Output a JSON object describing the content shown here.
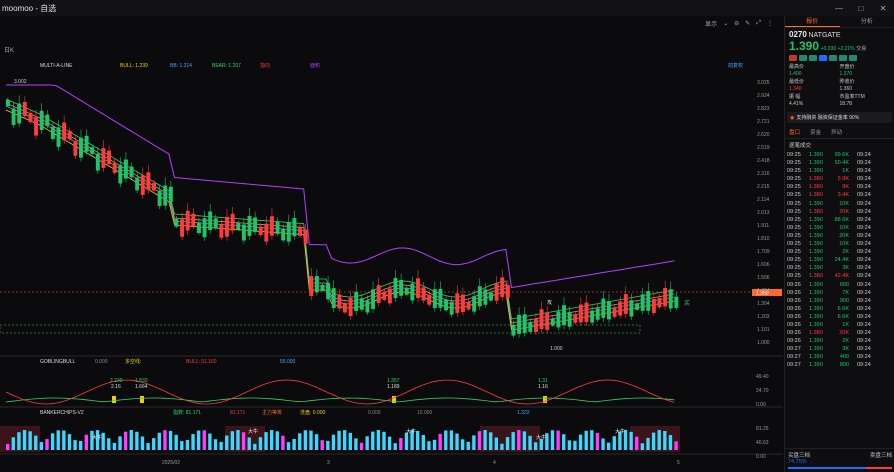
{
  "window": {
    "title": "moomoo - 自选",
    "controls": [
      "—",
      "□",
      "✕"
    ]
  },
  "toolbar": {
    "items": [
      "显示",
      "⌄",
      "⊖",
      "✎",
      "⤢",
      "⋮"
    ]
  },
  "chart": {
    "period_label": "日K",
    "indicator_main": {
      "name": "MULTI-A-LINE",
      "bull": "BULL: 1.239",
      "bb": "BB: 1.214",
      "bear": "BEAR: 1.207",
      "extra1": "指向",
      "extra2": "面积"
    },
    "adjust_label": "前复权",
    "price_axis": [
      "3.025",
      "2.924",
      "2.823",
      "2.721",
      "2.620",
      "2.519",
      "2.418",
      "2.316",
      "2.215",
      "2.114",
      "2.013",
      "1.911",
      "1.810",
      "1.709",
      "1.606",
      "1.506",
      "1.404",
      "1.304",
      "1.203",
      "1.101",
      "1.000"
    ],
    "current_price_tag": "1.390",
    "high_label": "3.002",
    "low_label": "1.000",
    "marker_buy": "买",
    "marker_b": "攻",
    "sub1": {
      "name": "GOBLINGBULL",
      "v1": "0.000",
      "lbl": "多空线:",
      "bull": "BULL: 51.160",
      "v2": "55.000",
      "axis": [
        "49.40",
        "24.70",
        "0.00"
      ],
      "labels": [
        [
          "2.239",
          "2.16"
        ],
        [
          "1.833",
          "1.664"
        ],
        [
          "1.357",
          "1.189"
        ],
        [
          "1.31",
          "1.16"
        ]
      ]
    },
    "sub2": {
      "name": "BANKERCHIPS-V2",
      "a": "指数: 81.171",
      "b": "81.171",
      "c": "主力等筹",
      "d": "洗盘: 0.000",
      "e": "0.000",
      "f": "10.000",
      "g": "1.322",
      "axis": [
        "81.25",
        "40.63",
        "0.00"
      ],
      "tags": [
        "大牛",
        "大牛",
        "大牛",
        "大牛",
        "大牛"
      ]
    },
    "x_axis": [
      "2025/02",
      "3",
      "4",
      "5"
    ]
  },
  "panel": {
    "tabs": [
      "报价",
      "分析"
    ],
    "code": "0270",
    "name": "NATGATE",
    "price": "1.390",
    "change": "+0.030 +2.21%",
    "change_more": "交易",
    "stats": [
      [
        "最高价",
        "1.400",
        "开盘价",
        "1.370"
      ],
      [
        "最低价",
        "1.340",
        "昨收价",
        "1.360"
      ],
      [
        "振   幅",
        "4.41%",
        "市盈率TTM",
        "18.78"
      ]
    ],
    "notice": "支持融资 融资保证金率 90%",
    "subtabs": [
      "盘口",
      "资金",
      "异动"
    ],
    "ticks_title": "逐笔成交",
    "ticks": [
      [
        "09:25",
        "1.390",
        "99.6K",
        "09:24"
      ],
      [
        "09:25",
        "1.390",
        "50.4K",
        "09:24"
      ],
      [
        "09:25",
        "1.390",
        "1K",
        "09:24"
      ],
      [
        "09:25",
        "1.380",
        "5.9K",
        "09:24"
      ],
      [
        "09:25",
        "1.380",
        "8K",
        "09:24"
      ],
      [
        "09:25",
        "1.380",
        "3.4K",
        "09:24"
      ],
      [
        "09:25",
        "1.390",
        "10K",
        "09:24"
      ],
      [
        "09:25",
        "1.380",
        "20K",
        "09:24"
      ],
      [
        "09:25",
        "1.390",
        "88.6K",
        "09:24"
      ],
      [
        "09:25",
        "1.390",
        "10K",
        "09:24"
      ],
      [
        "09:25",
        "1.390",
        "20K",
        "09:24"
      ],
      [
        "09:25",
        "1.390",
        "10K",
        "09:24"
      ],
      [
        "09:25",
        "1.390",
        "2K",
        "09:24"
      ],
      [
        "09:25",
        "1.390",
        "24.4K",
        "09:24"
      ],
      [
        "09:25",
        "1.390",
        "3K",
        "09:24"
      ],
      [
        "09:25",
        "1.380",
        "42.4K",
        "09:24"
      ],
      [
        "09:26",
        "1.390",
        "600",
        "09:24"
      ],
      [
        "09:26",
        "1.390",
        "7K",
        "09:24"
      ],
      [
        "09:26",
        "1.390",
        "900",
        "09:24"
      ],
      [
        "09:26",
        "1.390",
        "6.6K",
        "09:24"
      ],
      [
        "09:26",
        "1.390",
        "6.6K",
        "09:24"
      ],
      [
        "09:26",
        "1.390",
        "1K",
        "09:24"
      ],
      [
        "09:26",
        "1.380",
        "20K",
        "09:24"
      ],
      [
        "09:26",
        "1.390",
        "2K",
        "09:24"
      ],
      [
        "09:27",
        "1.390",
        "3K",
        "09:24"
      ],
      [
        "09:27",
        "1.390",
        "400",
        "09:24"
      ],
      [
        "09:27",
        "1.390",
        "800",
        "09:24"
      ]
    ],
    "buy_label": "买盘三档",
    "sell_label": "卖盘三档",
    "buy_pct": "74.75%",
    "buy_fraction": 0.7475,
    "colors": {
      "up": "#1fc46a",
      "down": "#ff3b3b",
      "accent": "#ff6a2b"
    }
  }
}
